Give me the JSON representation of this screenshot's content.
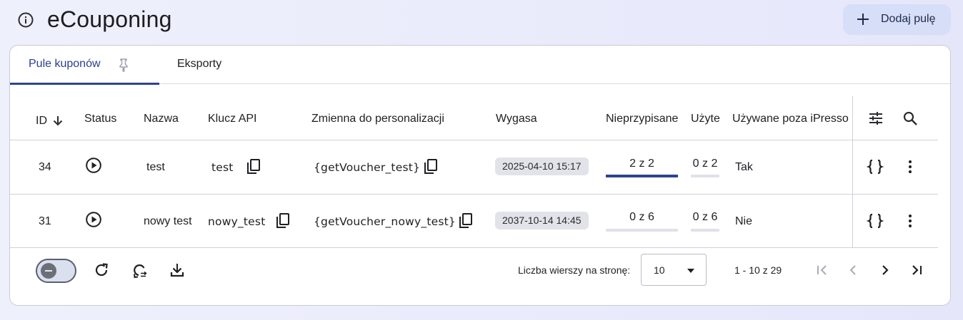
{
  "header": {
    "title": "eCouponing",
    "add_button": "Dodaj pulę"
  },
  "tabs": [
    {
      "label": "Pule kuponów",
      "active": true
    },
    {
      "label": "Eksporty",
      "active": false
    }
  ],
  "table": {
    "columns": [
      "ID",
      "Status",
      "Nazwa",
      "Klucz API",
      "Zmienna do personalizacji",
      "Wygasa",
      "Nieprzypisane",
      "Użyte",
      "Używane poza iPresso"
    ],
    "sort": {
      "column": "ID",
      "direction": "descending"
    },
    "rows": [
      {
        "id": "34",
        "status": "play-circle-icon",
        "name": "test",
        "api_key": "test",
        "variable": "{getVoucher_test}",
        "expires": "2025-04-10 15:17",
        "unassigned": "2 z 2",
        "unassigned_fraction": 1.0,
        "used": "0 z 2",
        "used_fraction": 0.0,
        "outside": "Tak"
      },
      {
        "id": "31",
        "status": "play-circle-icon",
        "name": "nowy test",
        "api_key": "nowy_test",
        "variable": "{getVoucher_nowy_test}",
        "expires": "2037-10-14 14:45",
        "unassigned": "0 z 6",
        "unassigned_fraction": 0.0,
        "used": "0 z 6",
        "used_fraction": 0.0,
        "outside": "Nie"
      }
    ]
  },
  "footer": {
    "rows_per_page_label": "Liczba wierszy na stronę:",
    "rows_per_page": "10",
    "range": "1 - 10 z 29"
  },
  "colors": {
    "accent": "#2e4390",
    "add_button_bg": "#d6def8",
    "chip_bg": "#e2e3e8"
  }
}
